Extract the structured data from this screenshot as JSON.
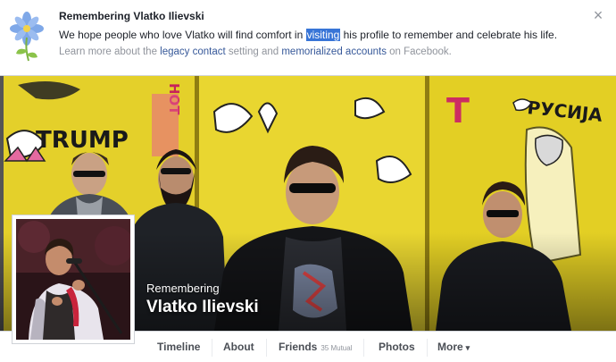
{
  "banner": {
    "title": "Remembering Vlatko Ilievski",
    "message_pre": "We hope people who love Vlatko will find comfort in ",
    "message_highlight": "visiting",
    "message_post": " his profile to remember and celebrate his life.",
    "learn_pre": "Learn more about the ",
    "learn_link1": "legacy contact",
    "learn_mid": " setting and ",
    "learn_link2": "memorialized accounts",
    "learn_post": " on Facebook.",
    "close_symbol": "×",
    "flower_icon": "memorial-flower-icon"
  },
  "cover": {
    "remembering_label": "Remembering",
    "profile_name": "Vlatko Ilievski",
    "graffiti": {
      "trump": "TRUMP",
      "hot": "HOT",
      "t": "T",
      "rysuja": "РУСИЈА"
    }
  },
  "nav": {
    "timeline": "Timeline",
    "about": "About",
    "friends": "Friends",
    "friends_mutual": "35 Mutual",
    "photos": "Photos",
    "more": "More",
    "more_caret": "▾"
  },
  "colors": {
    "link": "#365899",
    "highlight": "#3875d7",
    "wall_yellow": "#e6d21c"
  }
}
